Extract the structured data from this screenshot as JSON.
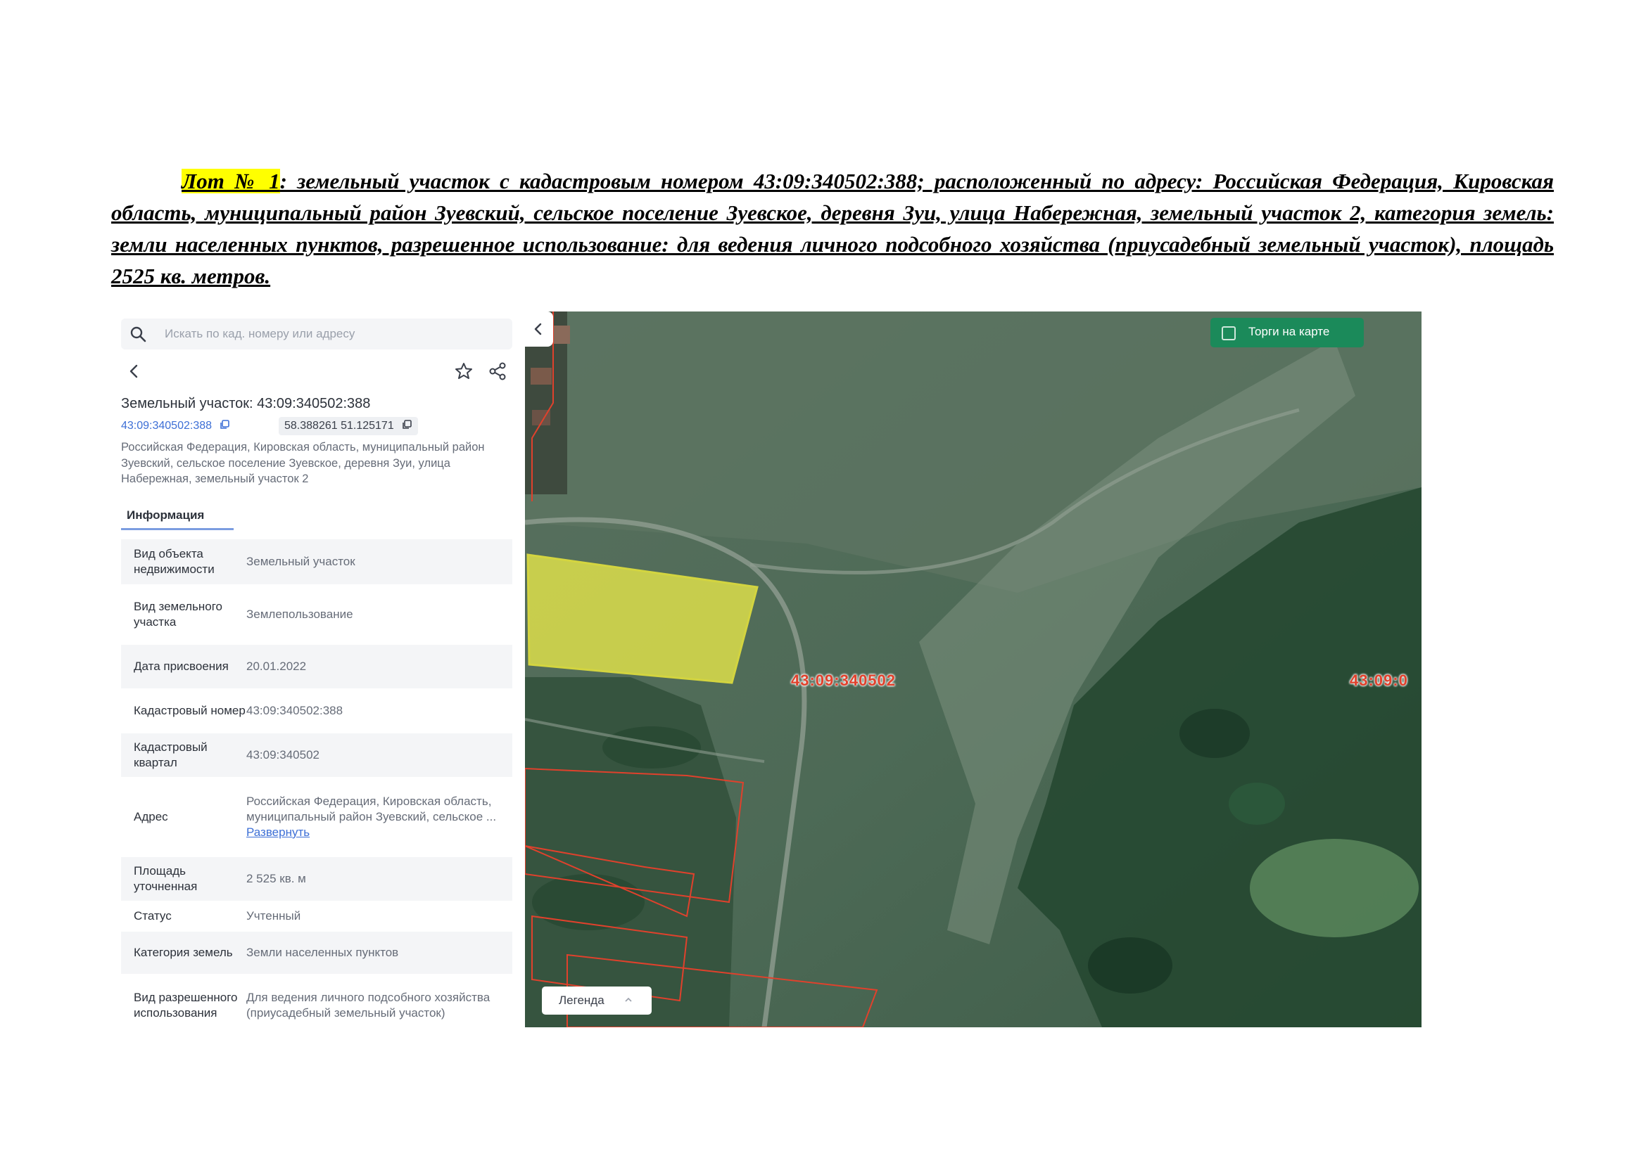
{
  "heading": {
    "lot": "Лот № 1",
    "text": ": земельный участок с кадастровым номером 43:09:340502:388; расположенный по адресу: Российская Федерация, Кировская область, муниципальный район Зуевский, сельское поселение Зуевское, деревня Зуи, улица Набережная, земельный участок 2,  категория земель: земли населенных пунктов, разрешенное использование: для ведения личного подсобного хозяйства (приусадебный земельный участок), площадь 2525 кв. метров."
  },
  "panel": {
    "search_placeholder": "Искать по кад. номеру или адресу",
    "title": "Земельный участок: 43:09:340502:388",
    "cad_number_chip": "43:09:340502:388",
    "coords_chip": "58.388261 51.125171",
    "address": "Российская Федерация, Кировская область, муниципальный район Зуевский, сельское поселение Зуевское, деревня Зуи, улица Набережная, земельный участок 2",
    "tab": "Информация",
    "rows": [
      {
        "label": "Вид объекта недвижимости",
        "value": "Земельный участок"
      },
      {
        "label": "Вид земельного участка",
        "value": "Землепользование"
      },
      {
        "label": "Дата присвоения",
        "value": "20.01.2022"
      },
      {
        "label": "Кадастровый номер",
        "value": "43:09:340502:388"
      },
      {
        "label": "Кадастровый квартал",
        "value": "43:09:340502"
      },
      {
        "label": "Адрес",
        "value": "Российская Федерация, Кировская область, муниципальный район Зуевский, сельское ...",
        "link": "Развернуть"
      },
      {
        "label": "Площадь уточненная",
        "value": "2 525 кв. м"
      },
      {
        "label": "Статус",
        "value": "Учтенный"
      },
      {
        "label": "Категория земель",
        "value": "Земли населенных пунктов"
      },
      {
        "label": "Вид разрешенного использования",
        "value": "Для ведения личного подсобного хозяйства (приусадебный земельный участок)"
      }
    ]
  },
  "map": {
    "torgi_label": "Торги на карте",
    "legend_label": "Легенда",
    "quarter_label_1": "43:09:340502",
    "quarter_label_2": "43:09:0",
    "colors": {
      "parcel_fill": "#e5e64a",
      "parcel_border": "#f4ef3a",
      "boundary": "#e0412c",
      "button": "#1b8a5a"
    }
  }
}
